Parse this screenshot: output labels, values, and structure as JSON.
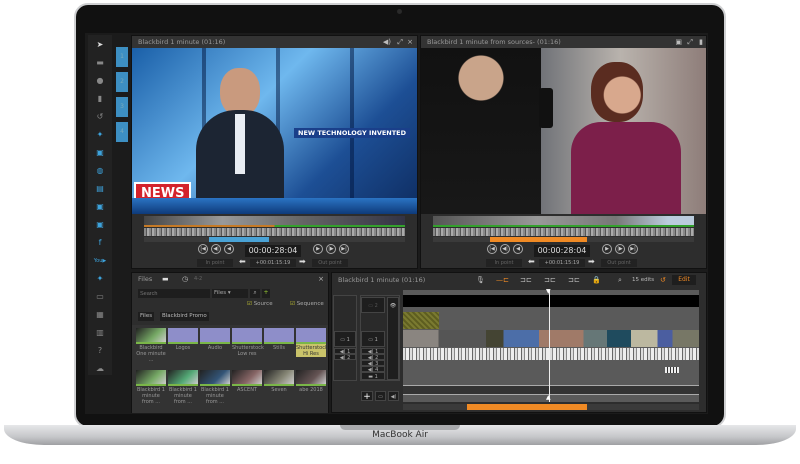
{
  "device": {
    "label": "MacBook Air"
  },
  "sidebar": {
    "items": [
      "logo",
      "folder",
      "upload",
      "trash",
      "history",
      "twitter",
      "news",
      "globe",
      "document",
      "news",
      "news",
      "facebook",
      "youtube",
      "twitter",
      "keyboard",
      "film",
      "chart",
      "help",
      "cloud"
    ],
    "thumb_tabs": [
      "1",
      "2",
      "3",
      "4"
    ]
  },
  "viewer_left": {
    "title": "Blackbird 1 minute (01:16)",
    "overlay_headline": "NEW TECHNOLOGY INVENTED",
    "overlay_news": "NEWS",
    "timecode": "00:00:28:04",
    "offset": "+00:01:15:19",
    "in_point": "In point",
    "out_point": "Out point",
    "range_color": "#4aa3d6"
  },
  "viewer_right": {
    "title": "Blackbird 1 minute from sources- (01:16)",
    "timecode": "00:00:28:04",
    "offset": "+00:01:15:19",
    "in_point": "In point",
    "out_point": "Out point",
    "range_color": "#f08a24"
  },
  "files": {
    "title": "Files",
    "count": "4-2",
    "search_placeholder": "Search",
    "filter": "Files",
    "source_label": "Source",
    "sequence_label": "Sequence",
    "breadcrumb": [
      "Files",
      "Blackbird Promo"
    ],
    "items": [
      {
        "name": "Blackbird One minute ...",
        "type": "video"
      },
      {
        "name": "Logos",
        "type": "folder"
      },
      {
        "name": "Audio",
        "type": "folder"
      },
      {
        "name": "Shutterstock Low res",
        "type": "folder"
      },
      {
        "name": "Stills",
        "type": "folder"
      },
      {
        "name": "Shutterstock Hi Res",
        "type": "folder",
        "selected": true
      },
      {
        "name": "Blackbird 1 minute from ...",
        "type": "video"
      },
      {
        "name": "Blackbird 1 minute from ...",
        "type": "video"
      },
      {
        "name": "Blackbird 1 minute from ...",
        "type": "video"
      },
      {
        "name": "ASCENT",
        "type": "video"
      },
      {
        "name": "Seven",
        "type": "video"
      },
      {
        "name": "abe 2018",
        "type": "video"
      }
    ]
  },
  "timeline": {
    "title": "Blackbird 1 minute  (01:16)",
    "edits": "15 edits",
    "edit_button": "Edit",
    "tracks": {
      "video": [
        "1",
        "2"
      ],
      "audio": [
        "1",
        "2",
        "3",
        "4"
      ],
      "text": "1"
    },
    "accent": "#f08a24"
  }
}
